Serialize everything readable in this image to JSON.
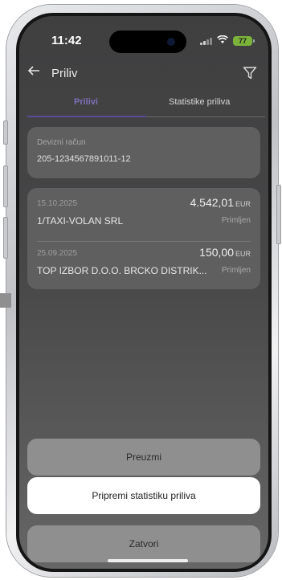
{
  "status_bar": {
    "time": "11:42",
    "battery": "77"
  },
  "header": {
    "title": "Priliv",
    "back_icon": "arrow-left-icon",
    "filter_icon": "filter-icon"
  },
  "tabs": [
    {
      "label": "Prilivi",
      "active": true
    },
    {
      "label": "Statistike priliva",
      "active": false
    }
  ],
  "account": {
    "label": "Devizni račun",
    "number": "205-1234567891011-12"
  },
  "transactions": [
    {
      "date": "15.10.2025",
      "amount": "4.542,01",
      "currency": "EUR",
      "name": "1/TAXI-VOLAN SRL",
      "status": "Primljen"
    },
    {
      "date": "25.09.2025",
      "amount": "150,00",
      "currency": "EUR",
      "name": "TOP IZBOR D.O.O. BRCKO DISTRIK...",
      "status": "Primljen"
    }
  ],
  "actions": {
    "download": "Preuzmi",
    "prepare_stats": "Pripremi statistiku priliva",
    "close": "Zatvori"
  },
  "colors": {
    "accent": "#5b4a98",
    "battery": "#7bb33a"
  }
}
